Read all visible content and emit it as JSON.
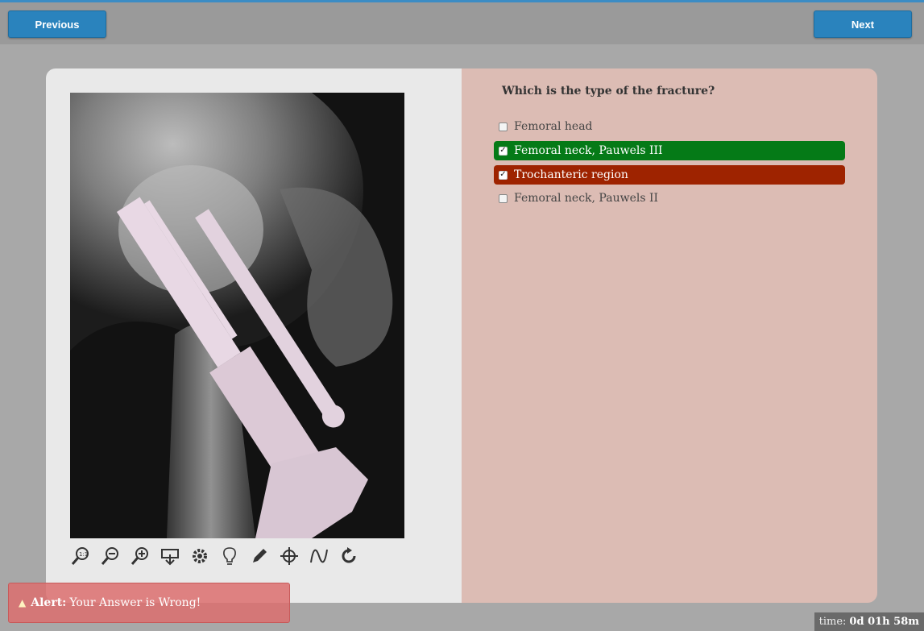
{
  "nav": {
    "previous_label": "Previous",
    "next_label": "Next"
  },
  "question": {
    "text": "Which is the type of the fracture?",
    "options": [
      {
        "label": "Femoral head",
        "checked": false,
        "state": "neutral"
      },
      {
        "label": "Femoral neck, Pauwels III",
        "checked": true,
        "state": "correct"
      },
      {
        "label": "Trochanteric region",
        "checked": true,
        "state": "wrong"
      },
      {
        "label": "Femoral neck, Pauwels II",
        "checked": false,
        "state": "neutral"
      }
    ]
  },
  "toolbar": {
    "tools": [
      "zoom-reset-icon",
      "zoom-out-icon",
      "zoom-in-icon",
      "fit-screen-icon",
      "settings-icon",
      "hint-icon",
      "pencil-icon",
      "crosshair-icon",
      "wave-icon",
      "rotate-icon"
    ]
  },
  "alert": {
    "label": "Alert:",
    "message": "Your Answer is Wrong!"
  },
  "timer": {
    "label": "time:",
    "value": "0d 01h 58m"
  },
  "colors": {
    "accent": "#2a83bd",
    "correct": "#057a17",
    "wrong": "#9e2300",
    "answer_pane": "#dcbcb4"
  }
}
